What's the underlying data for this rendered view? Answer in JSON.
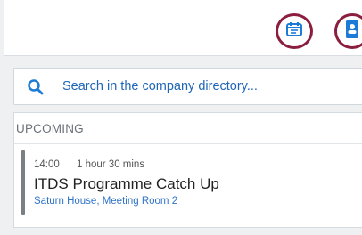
{
  "header": {
    "calendar_icon": "calendar-icon",
    "directory_icon": "contact-book-icon",
    "accent_color": "#8b1e3f",
    "icon_color": "#1d7bd8"
  },
  "search": {
    "icon": "search-icon",
    "placeholder": "Search in the company directory..."
  },
  "upcoming": {
    "heading": "UPCOMING",
    "meetings": [
      {
        "time": "14:00",
        "duration": "1 hour 30 mins",
        "title": "ITDS Programme Catch Up",
        "location": "Saturn House, Meeting Room 2"
      }
    ]
  }
}
